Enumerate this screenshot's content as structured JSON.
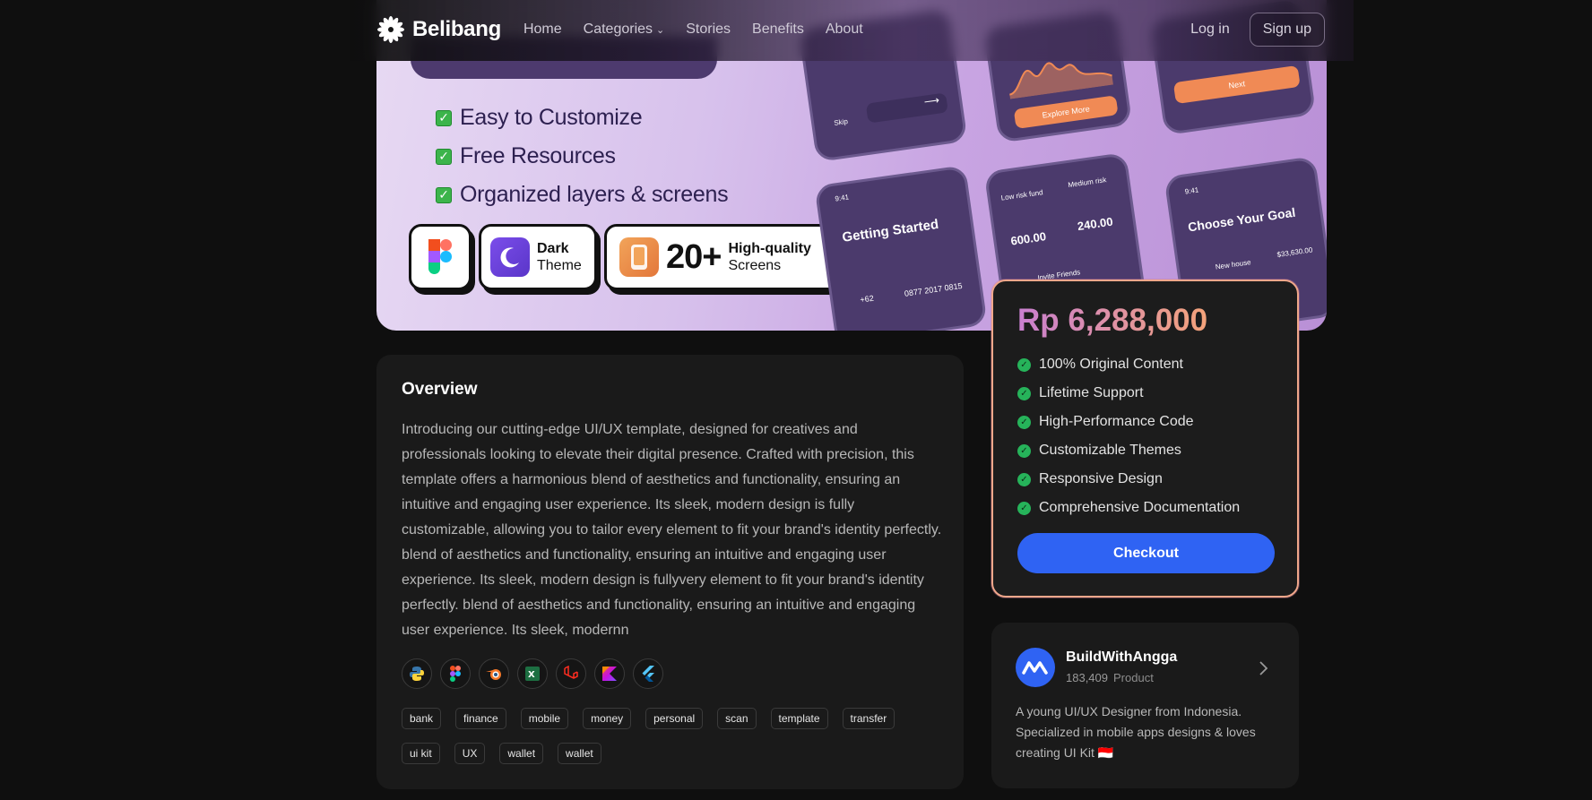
{
  "nav": {
    "brand": "Belibang",
    "links": [
      "Home",
      "Categories",
      "Stories",
      "Benefits",
      "About"
    ],
    "login": "Log in",
    "signup": "Sign up"
  },
  "hero": {
    "features": [
      "Easy to Customize",
      "Free Resources",
      "Organized layers & screens"
    ],
    "badge_dark_line1": "Dark",
    "badge_dark_line2": "Theme",
    "badge_count": "20+",
    "badge_screens_line1": "High-quality",
    "badge_screens_line2": "Screens",
    "mock": {
      "getting_started": "Getting Started",
      "choose_goal": "Choose Your Goal",
      "explore": "Explore More",
      "next": "Next",
      "skip": "Skip",
      "low_risk": "Low risk fund",
      "medium_risk": "Medium risk",
      "low_val": "600.00",
      "med_val": "240.00",
      "invite": "Invite Friends",
      "new_house": "New house",
      "amount": "$33,630.00",
      "phone_num": "0877 2017 0815",
      "code": "+62",
      "time": "9:41"
    }
  },
  "overview": {
    "title": "Overview",
    "body": "Introducing our cutting-edge UI/UX template, designed for creatives and professionals looking to elevate their digital presence. Crafted with precision, this template offers a harmonious blend of aesthetics and functionality, ensuring an intuitive and engaging user experience. Its sleek, modern design is fully customizable, allowing you to tailor every element to fit your brand's identity perfectly. blend of aesthetics and functionality, ensuring an intuitive and engaging user experience. Its sleek, modern design is fullyvery element to fit your brand's identity perfectly. blend of aesthetics and functionality, ensuring an intuitive and engaging user experience. Its sleek, modernn",
    "tools": [
      "python-icon",
      "figma-icon",
      "blender-icon",
      "excel-icon",
      "laravel-icon",
      "kotlin-icon",
      "flutter-icon"
    ],
    "tags": [
      "bank",
      "finance",
      "mobile",
      "money",
      "personal",
      "scan",
      "template",
      "transfer",
      "ui kit",
      "UX",
      "wallet",
      "wallet"
    ]
  },
  "pricing": {
    "price": "Rp 6,288,000",
    "benefits": [
      "100% Original Content",
      "Lifetime Support",
      "High-Performance Code",
      "Customizable Themes",
      "Responsive Design",
      "Comprehensive Documentation"
    ],
    "checkout": "Checkout"
  },
  "author": {
    "name": "BuildWithAngga",
    "count": "183,409",
    "type": "Product",
    "bio": "A young UI/UX Designer from Indonesia. Specialized in mobile apps designs & loves creating UI Kit 🇮🇩"
  },
  "colors": {
    "accent": "#2f63f3",
    "price_gradient_start": "#c97fd0",
    "price_gradient_end": "#f4a37a",
    "check": "#26b35a"
  }
}
